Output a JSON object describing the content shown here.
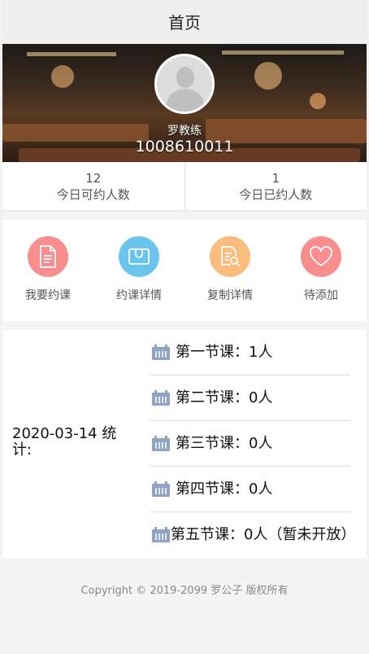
{
  "header": {
    "title": "首页"
  },
  "profile": {
    "name": "罗教练",
    "phone": "1008610011"
  },
  "stats": [
    {
      "value": "12",
      "label": "今日可约人数"
    },
    {
      "value": "1",
      "label": "今日已约人数"
    }
  ],
  "menu": [
    {
      "label": "我要约课",
      "icon": "document-icon",
      "color": "#f98c8c"
    },
    {
      "label": "约课详情",
      "icon": "wallet-icon",
      "color": "#69c5ee"
    },
    {
      "label": "复制详情",
      "icon": "search-document-icon",
      "color": "#fbbd7e"
    },
    {
      "label": "待添加",
      "icon": "heart-icon",
      "color": "#f98c8c"
    }
  ],
  "summary": {
    "date_label": "2020-03-14 统计:",
    "lessons": [
      {
        "text": "第一节课：1人"
      },
      {
        "text": "第二节课：0人"
      },
      {
        "text": "第三节课：0人"
      },
      {
        "text": "第四节课：0人"
      },
      {
        "text": "第五节课：0人（暂未开放）"
      }
    ]
  },
  "footer": {
    "copyright": "Copyright © 2019-2099 罗公子 版权所有"
  }
}
